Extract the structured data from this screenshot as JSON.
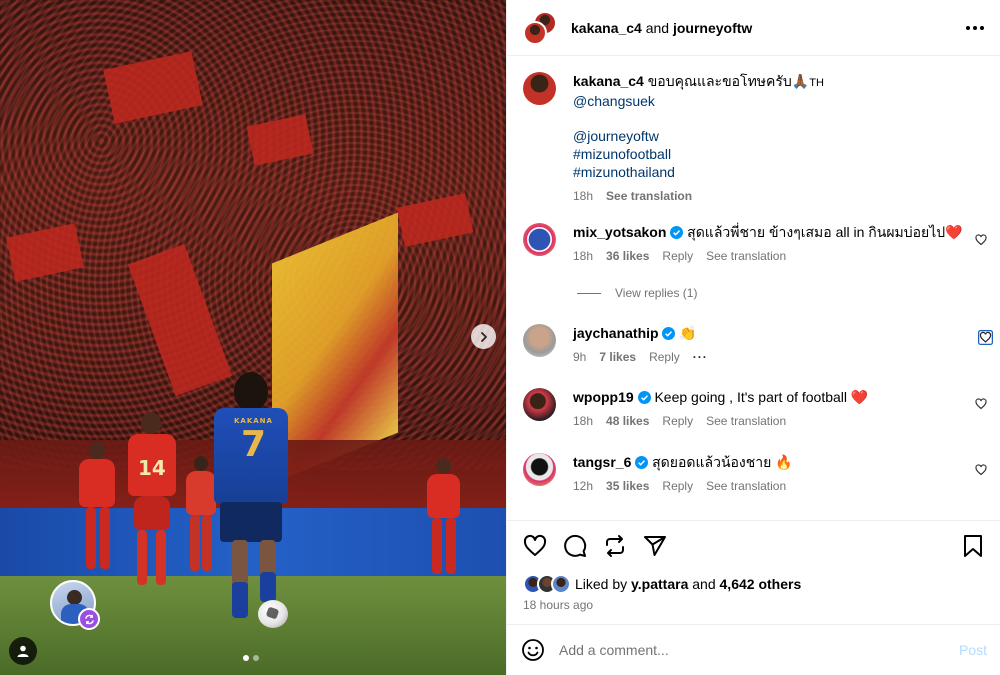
{
  "post": {
    "header": {
      "author": "kakana_c4",
      "and_text": "and",
      "coauthor": "journeyoftw"
    },
    "caption": {
      "username": "kakana_c4",
      "text": "ขอบคุณและขอโทษครับ🙏🏾",
      "suffix": "TH",
      "mentions": [
        "@changsuek",
        "@journeyoftw",
        "#mizunofootball",
        "#mizunothailand"
      ],
      "time": "18h",
      "see_translation": "See translation"
    },
    "comments": [
      {
        "username": "mix_yotsakon",
        "verified": true,
        "text": "สุดแล้วพี่ชาย ข้างๆเสมอ all in กินผมบ่อยไป❤️",
        "time": "18h",
        "likes": "36 likes",
        "reply": "Reply",
        "see_translation": "See translation",
        "view_replies": "View replies (1)"
      },
      {
        "username": "jaychanathip",
        "verified": true,
        "text": "👏",
        "time": "9h",
        "likes": "7 likes",
        "reply": "Reply"
      },
      {
        "username": "wpopp19",
        "verified": true,
        "text": "Keep going , It's part of football ❤️",
        "time": "18h",
        "likes": "48 likes",
        "reply": "Reply",
        "see_translation": "See translation"
      },
      {
        "username": "tangsr_6",
        "verified": true,
        "text": "สุดยอดแล้วน้องชาย 🔥",
        "time": "12h",
        "likes": "35 likes",
        "reply": "Reply",
        "see_translation": "See translation"
      }
    ],
    "likes": {
      "liked_by": "Liked by",
      "first_liker": "y.pattara",
      "and": "and",
      "others": "4,642 others"
    },
    "posted_ago": "18 hours ago",
    "comment_box": {
      "placeholder": "Add a comment...",
      "post_label": "Post"
    },
    "media": {
      "player_name": "KAKANA",
      "player_number": "7",
      "opponent_number": "14",
      "carousel_count": 2,
      "carousel_active": 1
    },
    "colors": {
      "link": "#00376b",
      "muted": "#737373",
      "heart": "#ed1c24",
      "verified": "#0095f6",
      "post_button": "#b3dbff"
    },
    "icons": [
      "heart-icon",
      "comment-icon",
      "repost-icon",
      "share-icon",
      "bookmark-icon",
      "emoji-icon",
      "chevron-right-icon",
      "reels-icon",
      "user-tag-icon",
      "more-icon",
      "verified-icon"
    ]
  }
}
